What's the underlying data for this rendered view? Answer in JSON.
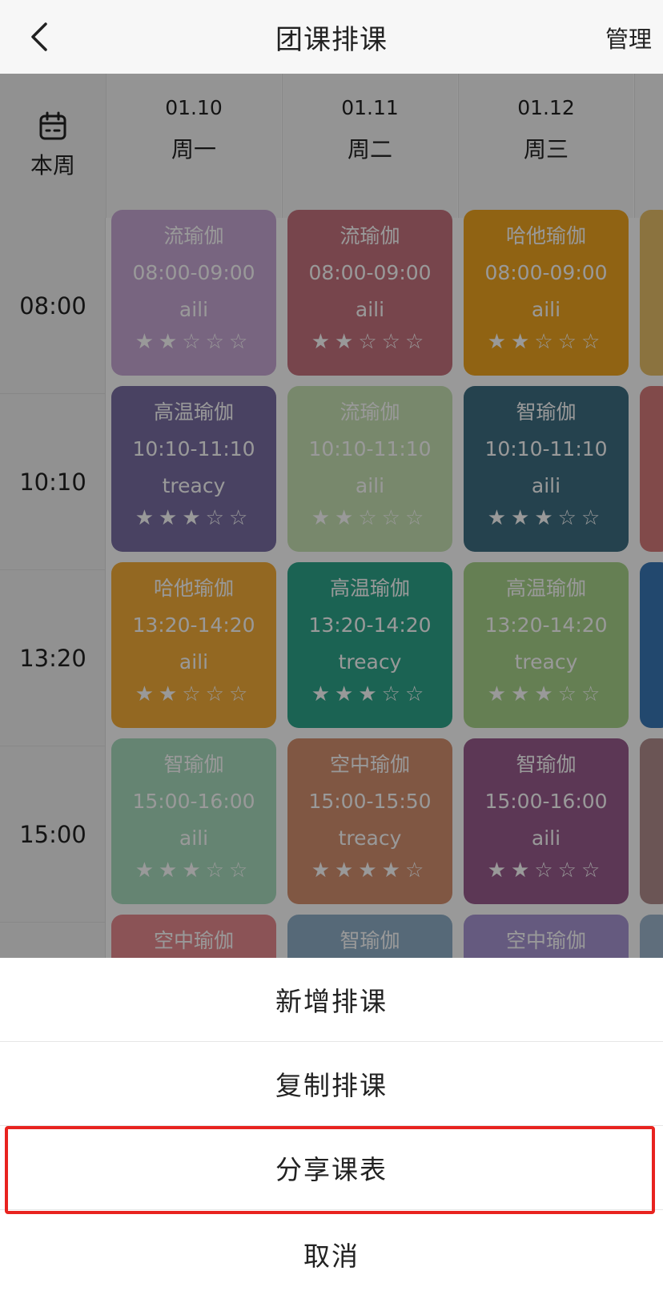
{
  "header": {
    "title": "团课排课",
    "manage_label": "管理",
    "back_icon": "chevron-left-icon"
  },
  "schedule": {
    "corner": {
      "icon": "calendar-icon",
      "label": "本周"
    },
    "days": [
      {
        "date": "01.10",
        "weekday": "周一"
      },
      {
        "date": "01.11",
        "weekday": "周二"
      },
      {
        "date": "01.12",
        "weekday": "周三"
      }
    ],
    "times": [
      "08:00",
      "10:10",
      "13:20",
      "15:00"
    ],
    "cards": [
      {
        "name": "流瑜伽",
        "time": "08:00-09:00",
        "teacher": "aili",
        "rating": 2,
        "color": "#c9a8d6"
      },
      {
        "name": "流瑜伽",
        "time": "08:00-09:00",
        "teacher": "aili",
        "rating": 2,
        "color": "#c7737f"
      },
      {
        "name": "哈他瑜伽",
        "time": "08:00-09:00",
        "teacher": "aili",
        "rating": 2,
        "color": "#f0a620"
      },
      {
        "name": "高温瑜伽",
        "time": "10:10-11:10",
        "teacher": "treacy",
        "rating": 3,
        "color": "#7a6fa3"
      },
      {
        "name": "流瑜伽",
        "time": "10:10-11:10",
        "teacher": "aili",
        "rating": 2,
        "color": "#c8e3b4"
      },
      {
        "name": "智瑜伽",
        "time": "10:10-11:10",
        "teacher": "aili",
        "rating": 3,
        "color": "#3f6f83"
      },
      {
        "name": "哈他瑜伽",
        "time": "13:20-14:20",
        "teacher": "aili",
        "rating": 2,
        "color": "#f5ad3a"
      },
      {
        "name": "高温瑜伽",
        "time": "13:20-14:20",
        "teacher": "treacy",
        "rating": 3,
        "color": "#2ea58b"
      },
      {
        "name": "高温瑜伽",
        "time": "13:20-14:20",
        "teacher": "treacy",
        "rating": 3,
        "color": "#a9d48b"
      },
      {
        "name": "智瑜伽",
        "time": "15:00-16:00",
        "teacher": "aili",
        "rating": 3,
        "color": "#a9dcbf"
      },
      {
        "name": "空中瑜伽",
        "time": "15:00-15:50",
        "teacher": "treacy",
        "rating": 4,
        "color": "#d69170"
      },
      {
        "name": "智瑜伽",
        "time": "15:00-16:00",
        "teacher": "aili",
        "rating": 2,
        "color": "#9a5d8e"
      },
      {
        "name": "空中瑜伽",
        "time": "",
        "teacher": "",
        "rating": 0,
        "color": "#e88a8f"
      },
      {
        "name": "智瑜伽",
        "time": "",
        "teacher": "",
        "rating": 0,
        "color": "#8fb0c9"
      },
      {
        "name": "空中瑜伽",
        "time": "",
        "teacher": "",
        "rating": 0,
        "color": "#a897d4"
      }
    ],
    "partial_column_colors": [
      "#e8c06a",
      "#d87c7c",
      "#3a79b8",
      "#b28e8e",
      "#9fb7cf"
    ]
  },
  "action_sheet": {
    "add_label": "新增排课",
    "copy_label": "复制排课",
    "share_label": "分享课表",
    "cancel_label": "取消"
  },
  "colors": {
    "highlight_border": "#e8231f",
    "overlay": "rgba(0,0,0,0.40)"
  }
}
